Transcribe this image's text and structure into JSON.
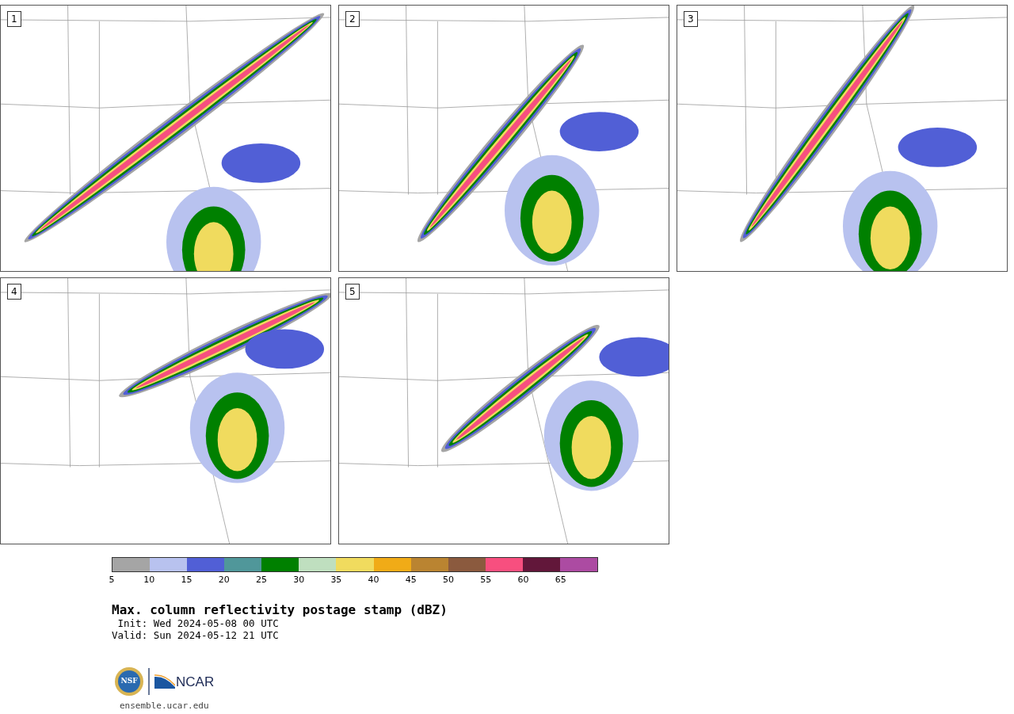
{
  "panels": [
    {
      "label": "1"
    },
    {
      "label": "2"
    },
    {
      "label": "3"
    },
    {
      "label": "4"
    },
    {
      "label": "5"
    }
  ],
  "colorbar": {
    "segments": [
      {
        "color": "#a5a5a5"
      },
      {
        "color": "#b8c2ef"
      },
      {
        "color": "#515fd6"
      },
      {
        "color": "#50979a"
      },
      {
        "color": "#008000"
      },
      {
        "color": "#bfdfbf"
      },
      {
        "color": "#f0db5e"
      },
      {
        "color": "#f0ab17"
      },
      {
        "color": "#ba8431"
      },
      {
        "color": "#8b5a3e"
      },
      {
        "color": "#f74f7f"
      },
      {
        "color": "#62173a"
      },
      {
        "color": "#ac4ba2"
      }
    ],
    "ticks": [
      "5",
      "10",
      "15",
      "20",
      "25",
      "30",
      "35",
      "40",
      "45",
      "50",
      "55",
      "60",
      "65"
    ]
  },
  "title": "Max. column reflectivity postage stamp (dBZ)",
  "init": " Init: Wed 2024-05-08 00 UTC",
  "valid": "Valid: Sun 2024-05-12 21 UTC",
  "logo": {
    "seal_text": "NSF",
    "wordmark": "NCAR"
  },
  "url": "ensemble.ucar.edu"
}
